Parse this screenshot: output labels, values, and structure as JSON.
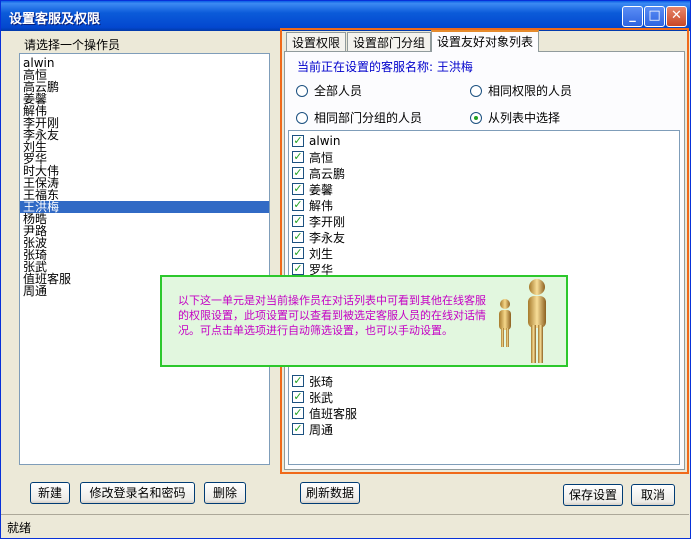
{
  "window": {
    "title": "设置客服及权限"
  },
  "titlebar_buttons": {
    "minimize": "_",
    "maximize": "□",
    "close": "✕"
  },
  "left": {
    "label": "请选择一个操作员",
    "operators": [
      "alwin",
      "高恒",
      "高云鹏",
      "姜馨",
      "解伟",
      "李开刚",
      "李永友",
      "刘生",
      "罗华",
      "时大伟",
      "王保涛",
      "王福东",
      "王洪梅",
      "杨晧",
      "尹路",
      "张波",
      "张琦",
      "张武",
      "值班客服",
      "周通"
    ],
    "selected": "王洪梅"
  },
  "tabs": [
    "设置权限",
    "设置部门分组",
    "设置友好对象列表"
  ],
  "active_tab": "设置友好对象列表",
  "panel": {
    "service_label": "当前正在设置的客服名称: 王洪梅",
    "radio_all": "全部人员",
    "radio_same_perm": "相同权限的人员",
    "radio_same_dept": "相同部门分组的人员",
    "radio_from_list": "从列表中选择",
    "selected_radio": "从列表中选择"
  },
  "checklist": {
    "top": [
      "alwin",
      "高恒",
      "高云鹏",
      "姜馨",
      "解伟",
      "李开刚",
      "李永友",
      "刘生",
      "罗华"
    ],
    "bottom": [
      "张琦",
      "张武",
      "值班客服",
      "周通"
    ]
  },
  "tooltip": {
    "text": "以下这一单元是对当前操作员在对话列表中可看到其他在线客服的权限设置，此项设置可以查看到被选定客服人员的在线对话情况。可点击单选项进行自动筛选设置，也可以手动设置。"
  },
  "buttons": {
    "new": "新建",
    "edit_login": "修改登录名和密码",
    "delete": "删除",
    "refresh": "刷新数据",
    "save": "保存设置",
    "cancel": "取消"
  },
  "status": {
    "text": "就绪"
  },
  "colors": {
    "accent": "#316AC5",
    "tab_border": "#F06A1A",
    "tooltip_border": "#2CC82C",
    "tooltip_text": "#C400C4",
    "label_blue": "#0000CC"
  }
}
